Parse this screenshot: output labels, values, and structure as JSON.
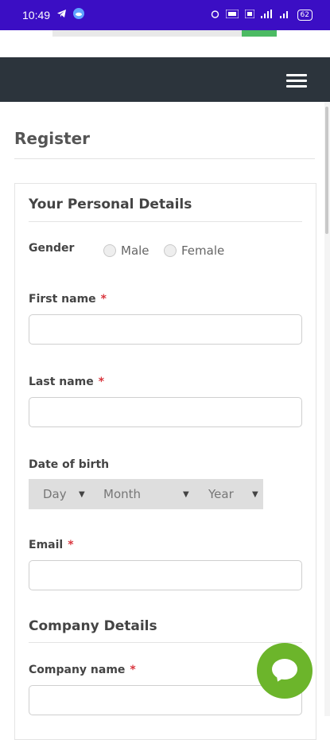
{
  "status_bar": {
    "time": "10:49",
    "battery": "62"
  },
  "page": {
    "title": "Register"
  },
  "personal_details": {
    "heading": "Your Personal Details",
    "gender_label": "Gender",
    "gender_options": [
      "Male",
      "Female"
    ],
    "first_name_label": "First name",
    "last_name_label": "Last name",
    "dob_label": "Date of birth",
    "dob_day": "Day",
    "dob_month": "Month",
    "dob_year": "Year",
    "email_label": "Email",
    "required_marker": "*"
  },
  "company_details": {
    "heading": "Company Details",
    "company_name_label": "Company name",
    "required_marker": "*"
  },
  "colors": {
    "status_bar": "#3b0ec4",
    "navbar": "#2c343c",
    "chat_button": "#6cb52b",
    "required": "#d9363e"
  }
}
